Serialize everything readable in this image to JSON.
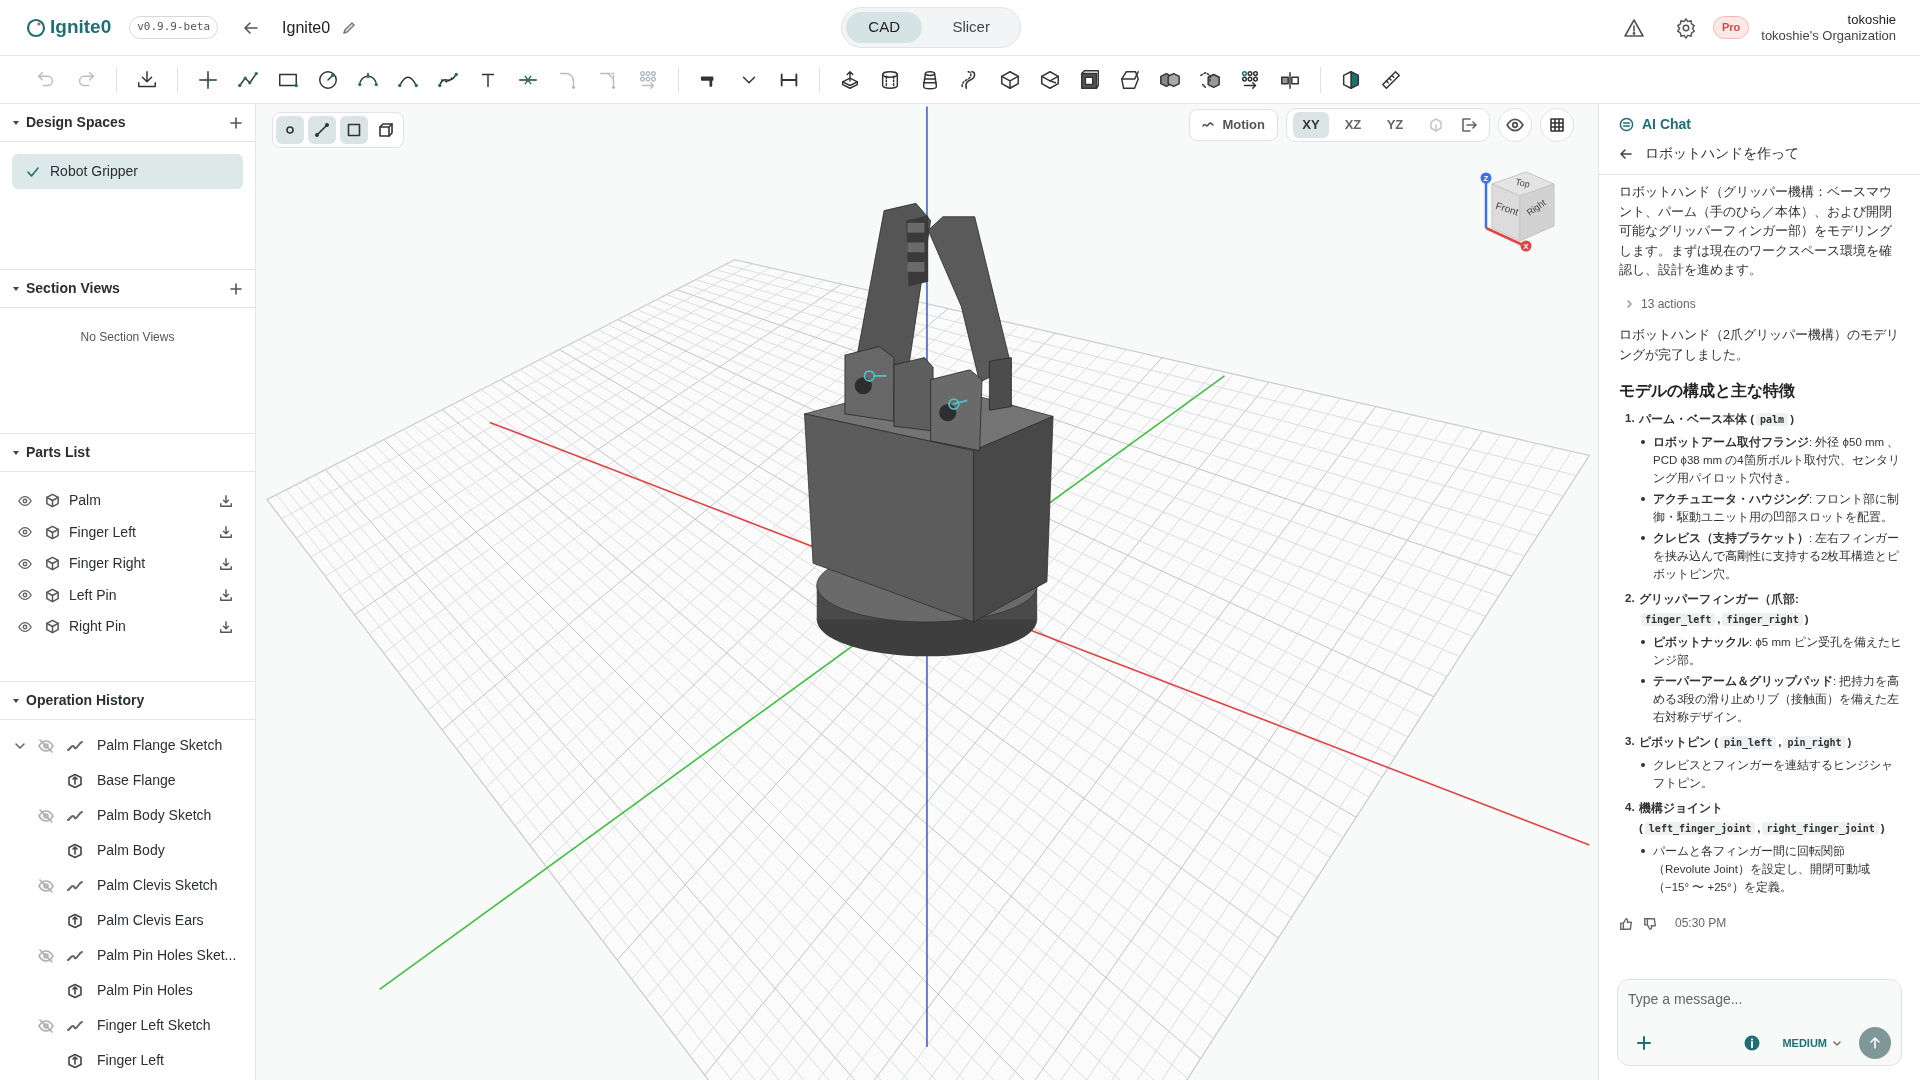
{
  "header": {
    "logo": "Ignite0",
    "version": "v0.9.9-beta",
    "project": "Ignite0",
    "modes": [
      {
        "label": "CAD",
        "selected": true
      },
      {
        "label": "Slicer",
        "selected": false
      }
    ],
    "plan": "Pro",
    "user": "tokoshie",
    "organization": "tokoshie's Organization"
  },
  "toolbar": [
    {
      "kind": "undo",
      "disabled": true
    },
    {
      "kind": "redo",
      "disabled": true
    },
    {
      "kind": "separator"
    },
    {
      "kind": "import",
      "disabled": false
    },
    {
      "kind": "separator"
    },
    {
      "kind": "point",
      "disabled": false
    },
    {
      "kind": "polyline",
      "disabled": false
    },
    {
      "kind": "rectangle",
      "disabled": false
    },
    {
      "kind": "circle",
      "disabled": false
    },
    {
      "kind": "arc3",
      "disabled": false
    },
    {
      "kind": "arc",
      "disabled": false
    },
    {
      "kind": "spline",
      "disabled": false
    },
    {
      "kind": "text",
      "disabled": false
    },
    {
      "kind": "trim",
      "disabled": false
    },
    {
      "kind": "fillet",
      "disabled": true
    },
    {
      "kind": "chamfer",
      "disabled": true
    },
    {
      "kind": "pattern",
      "disabled": true
    },
    {
      "kind": "separator"
    },
    {
      "kind": "constraint",
      "disabled": false
    },
    {
      "kind": "dropdown",
      "disabled": false
    },
    {
      "kind": "dimension",
      "disabled": false
    },
    {
      "kind": "separator"
    },
    {
      "kind": "extrude",
      "disabled": false
    },
    {
      "kind": "revolve",
      "disabled": false
    },
    {
      "kind": "loft",
      "disabled": false
    },
    {
      "kind": "sweep",
      "disabled": false
    },
    {
      "kind": "box",
      "disabled": false
    },
    {
      "kind": "cutbox",
      "disabled": false
    },
    {
      "kind": "shell",
      "disabled": false
    },
    {
      "kind": "draft",
      "disabled": false
    },
    {
      "kind": "union",
      "disabled": false
    },
    {
      "kind": "move",
      "disabled": false
    },
    {
      "kind": "pattern3d",
      "disabled": false
    },
    {
      "kind": "mirror",
      "disabled": false
    },
    {
      "kind": "separator"
    },
    {
      "kind": "appearance",
      "disabled": false
    },
    {
      "kind": "measure",
      "disabled": false
    }
  ],
  "design_spaces": {
    "title": "Design Spaces",
    "items": [
      {
        "label": "Robot Gripper",
        "selected": true
      }
    ]
  },
  "section_views": {
    "title": "Section Views",
    "empty": "No Section Views"
  },
  "parts_list": {
    "title": "Parts List",
    "items": [
      {
        "name": "Palm",
        "visible": true
      },
      {
        "name": "Finger Left",
        "visible": true
      },
      {
        "name": "Finger Right",
        "visible": true
      },
      {
        "name": "Left Pin",
        "visible": true
      },
      {
        "name": "Right Pin",
        "visible": true
      }
    ]
  },
  "operation_history": {
    "title": "Operation History",
    "expanded": true,
    "items": [
      {
        "kind": "sketch",
        "name": "Palm Flange Sketch",
        "visible": false
      },
      {
        "kind": "feature",
        "name": "Base Flange"
      },
      {
        "kind": "sketch",
        "name": "Palm Body Sketch",
        "visible": false
      },
      {
        "kind": "feature",
        "name": "Palm Body"
      },
      {
        "kind": "sketch",
        "name": "Palm Clevis Sketch",
        "visible": false
      },
      {
        "kind": "feature",
        "name": "Palm Clevis Ears"
      },
      {
        "kind": "sketch",
        "name": "Palm Pin Holes Sket...",
        "visible": false
      },
      {
        "kind": "feature",
        "name": "Palm Pin Holes"
      },
      {
        "kind": "sketch",
        "name": "Finger Left Sketch",
        "visible": false
      },
      {
        "kind": "feature",
        "name": "Finger Left"
      }
    ]
  },
  "viewport": {
    "selection_filters": [
      {
        "kind": "point",
        "selected": true
      },
      {
        "kind": "edge",
        "selected": true
      },
      {
        "kind": "face",
        "selected": true
      },
      {
        "kind": "body",
        "selected": false
      }
    ],
    "motion": "Motion",
    "planes": [
      {
        "label": "XY",
        "selected": true
      },
      {
        "label": "XZ",
        "selected": false
      },
      {
        "label": "YZ",
        "selected": false
      }
    ],
    "view_cube": {
      "faces": [
        "Top",
        "Front",
        "Right"
      ],
      "axes": [
        "Z",
        "X"
      ]
    }
  },
  "chat": {
    "title": "AI Chat",
    "thread": "ロボットハンドを作って",
    "intro": "ロボットハンド（グリッパー機構：ベースマウント、パーム（手のひら／本体）、および開閉可能なグリッパーフィンガー部）をモデリングします。まずは現在のワークスペース環境を確認し、設計を進めます。",
    "actions": {
      "label": "13 actions",
      "expanded": false
    },
    "summary": "ロボットハンド（2爪グリッパー機構）のモデリングが完了しました。",
    "heading": "モデルの構成と主な特徴",
    "sections": [
      {
        "number": "1.",
        "title": [
          {
            "kind": "text",
            "text": "パーム・ベース本体 ("
          },
          {
            "kind": "code",
            "text": "palm"
          },
          {
            "kind": "text",
            "text": ")"
          }
        ],
        "bullets": [
          "**ロボットアーム取付フランジ**: 外径 ϕ50 mm 、PCD ϕ38 mm の4箇所ボルト取付穴、センタリング用パイロット穴付き。",
          "**アクチュエータ・ハウジング**: フロント部に制御・駆動ユニット用の凹部スロットを配置。",
          "**クレビス（支持ブラケット）**: 左右フィンガーを挟み込んで高剛性に支持する2枚耳構造とピボットピン穴。"
        ]
      },
      {
        "number": "2.",
        "title": [
          {
            "kind": "text",
            "text": "グリッパーフィンガー（爪部: "
          },
          {
            "kind": "code",
            "text": "finger_left"
          },
          {
            "kind": "text",
            "text": ","
          },
          {
            "kind": "code",
            "text": "finger_right"
          },
          {
            "kind": "text",
            "text": ")"
          }
        ],
        "bullets": [
          "**ピボットナックル**: ϕ5 mm ピン受孔を備えたヒンジ部。",
          "**テーパーアーム＆グリップパッド**: 把持力を高める3段の滑り止めリブ（接触面）を備えた左右対称デザイン。"
        ]
      },
      {
        "number": "3.",
        "title": [
          {
            "kind": "text",
            "text": "ピボットピン ("
          },
          {
            "kind": "code",
            "text": "pin_left"
          },
          {
            "kind": "text",
            "text": ","
          },
          {
            "kind": "code",
            "text": "pin_right"
          },
          {
            "kind": "text",
            "text": ")"
          }
        ],
        "bullets": [
          "クレビスとフィンガーを連結するヒンジシャフトピン。"
        ]
      },
      {
        "number": "4.",
        "title": [
          {
            "kind": "text",
            "text": "機構ジョイント ("
          },
          {
            "kind": "code",
            "text": "left_finger_joint"
          },
          {
            "kind": "text",
            "text": ","
          },
          {
            "kind": "code",
            "text": "right_finger_joint"
          },
          {
            "kind": "text",
            "text": ")"
          }
        ],
        "bullets": [
          "パームと各フィンガー間に回転関節（Revolute Joint）を設定し、開閉可動域（−15° 〜 +25°）を定義。"
        ]
      }
    ],
    "time": "05:30 PM",
    "input": {
      "placeholder": "Type a message..."
    },
    "effort": "MEDIUM"
  }
}
